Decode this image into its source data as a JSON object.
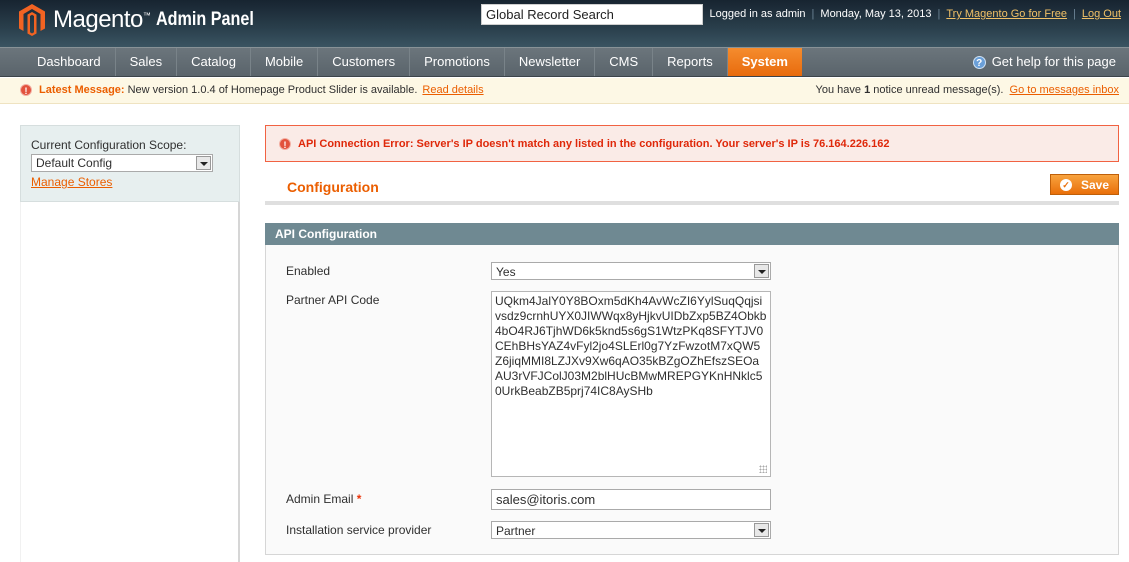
{
  "header": {
    "brand": "Magento",
    "brand_tm": "™",
    "brand_sub": "Admin Panel",
    "search_placeholder": "Global Record Search",
    "logged_in": "Logged in as admin",
    "date": "Monday, May 13, 2013",
    "try_link": "Try Magento Go for Free",
    "logout": "Log Out"
  },
  "nav": {
    "items": [
      {
        "label": "Dashboard"
      },
      {
        "label": "Sales"
      },
      {
        "label": "Catalog"
      },
      {
        "label": "Mobile"
      },
      {
        "label": "Customers"
      },
      {
        "label": "Promotions"
      },
      {
        "label": "Newsletter"
      },
      {
        "label": "CMS"
      },
      {
        "label": "Reports"
      },
      {
        "label": "System",
        "active": true
      }
    ],
    "help": "Get help for this page",
    "active_color": "#eb6d0e"
  },
  "message_bar": {
    "label": "Latest Message:",
    "text": "New version 1.0.4 of Homepage Product Slider is available.",
    "link": "Read details",
    "unread_prefix": "You have",
    "unread_count": "1",
    "unread_suffix": "notice unread message(s).",
    "inbox_link": "Go to messages inbox"
  },
  "sidebar": {
    "scope_label": "Current Configuration Scope:",
    "scope_value": "Default Config",
    "manage_stores": "Manage Stores"
  },
  "error": {
    "text": "API Connection Error: Server's IP doesn't match any listed in the configuration. Your server's IP is 76.164.226.162"
  },
  "content": {
    "title": "Configuration",
    "save_label": "Save",
    "fieldset_title": "API Configuration",
    "fields": {
      "enabled": {
        "label": "Enabled",
        "value": "Yes"
      },
      "api_code": {
        "label": "Partner API Code",
        "value": "UQkm4JalY0Y8BOxm5dKh4AvWcZI6YylSuqQqjsivsdz9crnhUYX0JIWWqx8yHjkvUIDbZxp5BZ4Obkb4bO4RJ6TjhWD6k5knd5s6gS1WtzPKq8SFYTJV0CEhBHsYAZ4vFyl2jo4SLErl0g7YzFwzotM7xQW5Z6jiqMMI8LZJXv9Xw6qAO35kBZgOZhEfszSEOaAU3rVFJColJ03M2blHUcBMwMREPGYKnHNklc50UrkBeabZB5prj74IC8AySHb"
      },
      "admin_email": {
        "label": "Admin Email",
        "required_mark": "*",
        "value": "sales@itoris.com"
      },
      "provider": {
        "label": "Installation service provider",
        "value": "Partner"
      }
    }
  },
  "colors": {
    "accent": "#eb5e00",
    "error": "#df280a",
    "fieldset_header": "#6f8992"
  }
}
